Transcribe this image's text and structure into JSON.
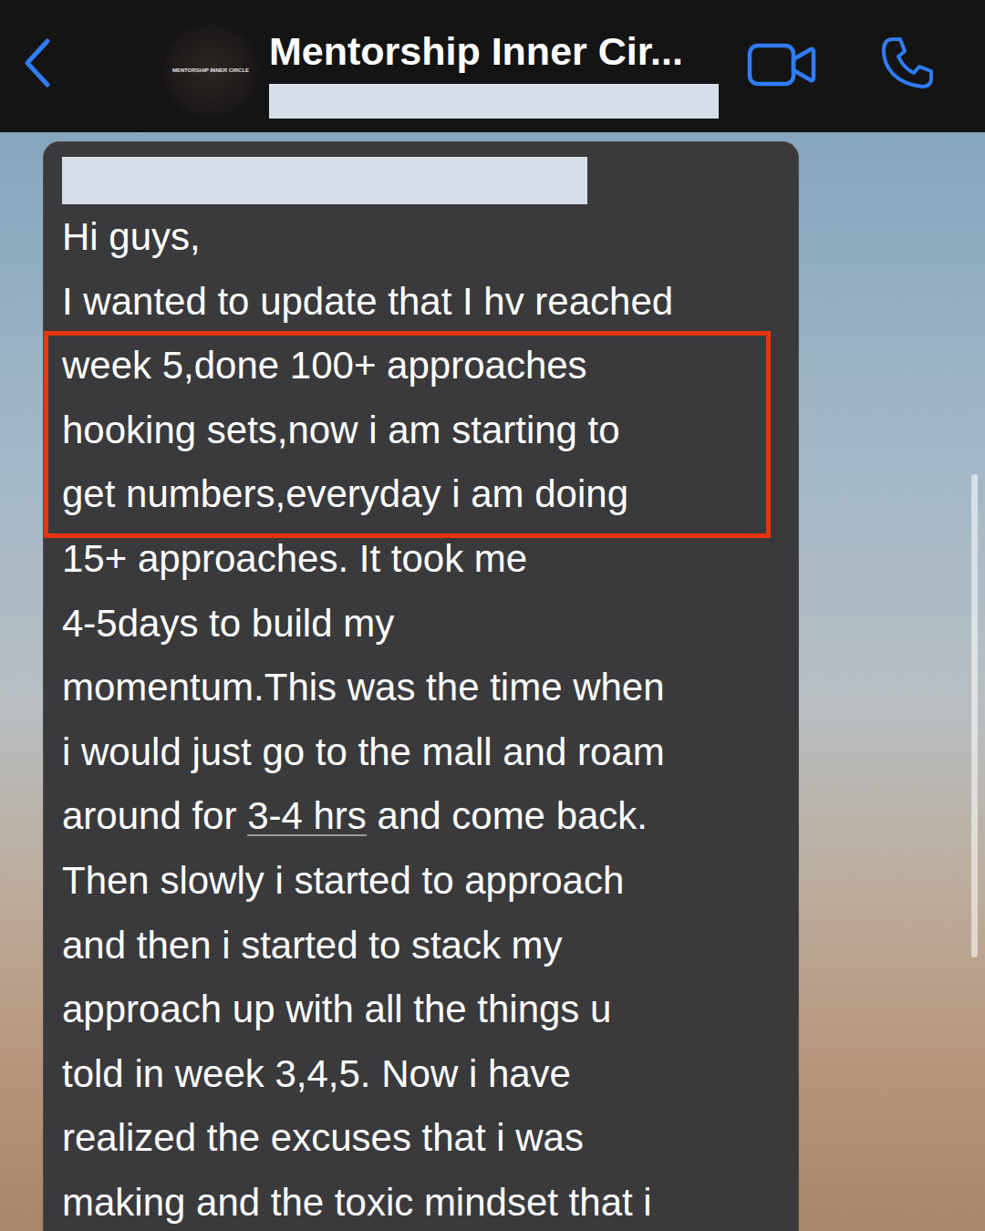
{
  "header": {
    "avatar_text": "MENTORSHIP INNER CIRCLE",
    "title": "Mentorship Inner Cir..."
  },
  "message": {
    "lines": [
      {
        "highlighted": false,
        "segments": [
          {
            "text": "Hi guys,",
            "underlined": false
          }
        ]
      },
      {
        "highlighted": false,
        "segments": [
          {
            "text": "I wanted to update that I hv reached",
            "underlined": false
          }
        ]
      },
      {
        "highlighted": true,
        "segments": [
          {
            "text": "week 5,done 100+ approaches",
            "underlined": false
          }
        ]
      },
      {
        "highlighted": true,
        "segments": [
          {
            "text": "hooking sets,now i am starting to",
            "underlined": false
          }
        ]
      },
      {
        "highlighted": true,
        "segments": [
          {
            "text": "get numbers,everyday i am doing",
            "underlined": false
          }
        ]
      },
      {
        "highlighted": false,
        "segments": [
          {
            "text": "15+ approaches. It took me",
            "underlined": false
          }
        ]
      },
      {
        "highlighted": false,
        "segments": [
          {
            "text": "4-5days to build my",
            "underlined": false
          }
        ]
      },
      {
        "highlighted": false,
        "segments": [
          {
            "text": "momentum.This was the time when",
            "underlined": false
          }
        ]
      },
      {
        "highlighted": false,
        "segments": [
          {
            "text": "i would just go to the mall and roam",
            "underlined": false
          }
        ]
      },
      {
        "highlighted": false,
        "segments": [
          {
            "text": "around for ",
            "underlined": false
          },
          {
            "text": "3-4 hrs",
            "underlined": true
          },
          {
            "text": " and come back.",
            "underlined": false
          }
        ]
      },
      {
        "highlighted": false,
        "segments": [
          {
            "text": "Then slowly i started to approach",
            "underlined": false
          }
        ]
      },
      {
        "highlighted": false,
        "segments": [
          {
            "text": "and then i started to stack my",
            "underlined": false
          }
        ]
      },
      {
        "highlighted": false,
        "segments": [
          {
            "text": "approach up with all the things u",
            "underlined": false
          }
        ]
      },
      {
        "highlighted": false,
        "segments": [
          {
            "text": "told in week 3,4,5. Now i have",
            "underlined": false
          }
        ]
      },
      {
        "highlighted": false,
        "segments": [
          {
            "text": "realized the excuses that i was",
            "underlined": false
          }
        ]
      },
      {
        "highlighted": false,
        "segments": [
          {
            "text": "making and the toxic mindset that i",
            "underlined": false
          }
        ]
      }
    ]
  }
}
